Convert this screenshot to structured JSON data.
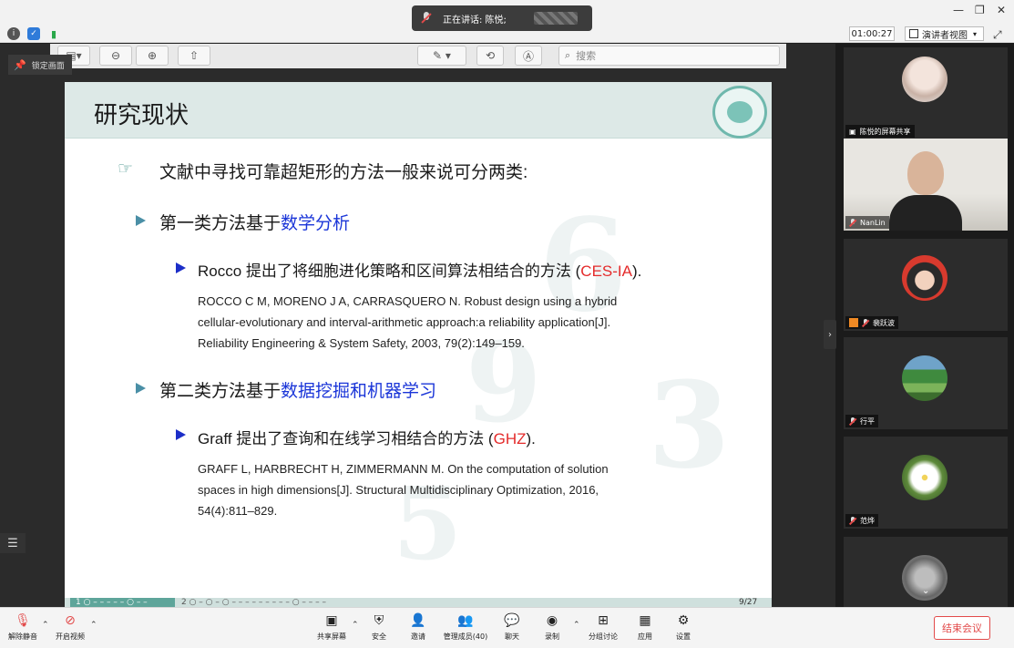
{
  "topbar": {
    "speaking_label": "正在讲话: 陈悦;",
    "timer": "01:00:27",
    "view_label": "演讲者视图"
  },
  "viewer": {
    "search_placeholder": "搜索"
  },
  "pin_label": "锁定画面",
  "slide": {
    "title": "研究现状",
    "line1": "文献中寻找可靠超矩形的方法一般来说可分两类:",
    "cat1_prefix": "第一类方法基于",
    "cat1_highlight": "数学分析",
    "item1_prefix": "Rocco 提出了将细胞进化策略和区间算法相结合的方法 (",
    "item1_highlight": "CES-IA",
    "item1_suffix": ").",
    "ref1_l1": "ROCCO C M, MORENO J A, CARRASQUERO N. Robust design using a hybrid",
    "ref1_l2": "cellular-evolutionary and interval-arithmetic approach:a reliability application[J].",
    "ref1_l3": "Reliability Engineering & System Safety, 2003, 79(2):149–159.",
    "cat2_prefix": "第二类方法基于",
    "cat2_highlight": "数据挖掘和机器学习",
    "item2_prefix": "Graff 提出了查询和在线学习相结合的方法 (",
    "item2_highlight": "GHZ",
    "item2_suffix": ").",
    "ref2_l1": "GRAFF L, HARBRECHT H, ZIMMERMANN M. On the computation of solution",
    "ref2_l2": "spaces in high dimensions[J]. Structural Multidisciplinary Optimization, 2016,",
    "ref2_l3": "54(4):811–829.",
    "nav_seg": "1  ○ – – – – – ○ – –",
    "nav_rest": "2  ○ – ○ – ○ – – – – – – – – – ○ – – – –",
    "page": "9/27"
  },
  "participants": [
    {
      "name": "陈悦的屏幕共享"
    },
    {
      "name": "NanLin"
    },
    {
      "name": "裴跃波"
    },
    {
      "name": "行平"
    },
    {
      "name": "范烨"
    },
    {
      "name": ""
    }
  ],
  "bottom": {
    "mute": "解除静音",
    "video": "开启视频",
    "share": "共享屏幕",
    "security": "安全",
    "invite": "邀请",
    "members": "管理成员(40)",
    "chat": "聊天",
    "record": "录制",
    "breakout": "分组讨论",
    "apps": "应用",
    "settings": "设置",
    "end": "结束会议"
  }
}
